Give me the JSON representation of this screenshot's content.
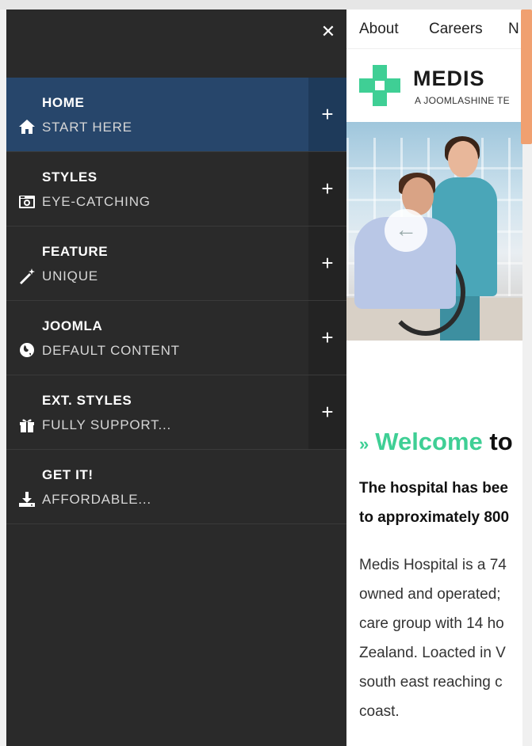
{
  "page": {
    "topnav": [
      "About",
      "Careers",
      "N"
    ],
    "brand": "MEDIS",
    "tagline": "A JOOMLASHINE TE",
    "welcome": {
      "prefix": "»",
      "word1": "Welcome",
      "word2": "to"
    },
    "lead_lines": [
      "The hospital has bee",
      "to approximately 800"
    ],
    "body_lines": [
      "Medis Hospital is a 74",
      "owned and operated;",
      "care group with 14 ho",
      "Zealand. Loacted in V",
      "south east reaching c",
      "coast."
    ],
    "hero_arrow": "←",
    "accent_color": "#3fcf95"
  },
  "menu": {
    "close_label": "✕",
    "toggle_label": "+",
    "items": [
      {
        "title": "HOME",
        "subtitle": "START HERE",
        "icon": "home-icon",
        "active": true,
        "has_toggle": true
      },
      {
        "title": "STYLES",
        "subtitle": "EYE-CATCHING",
        "icon": "camera-icon",
        "active": false,
        "has_toggle": true
      },
      {
        "title": "FEATURE",
        "subtitle": "UNIQUE",
        "icon": "magic-wand-icon",
        "active": false,
        "has_toggle": true
      },
      {
        "title": "JOOMLA",
        "subtitle": "DEFAULT CONTENT",
        "icon": "globe-icon",
        "active": false,
        "has_toggle": true
      },
      {
        "title": "EXT. STYLES",
        "subtitle": "FULLY SUPPORT...",
        "icon": "gift-icon",
        "active": false,
        "has_toggle": true
      },
      {
        "title": "GET IT!",
        "subtitle": "AFFORDABLE...",
        "icon": "download-icon",
        "active": false,
        "has_toggle": false
      }
    ],
    "active_color": "#27466b",
    "background_color": "#2a2a2a"
  }
}
